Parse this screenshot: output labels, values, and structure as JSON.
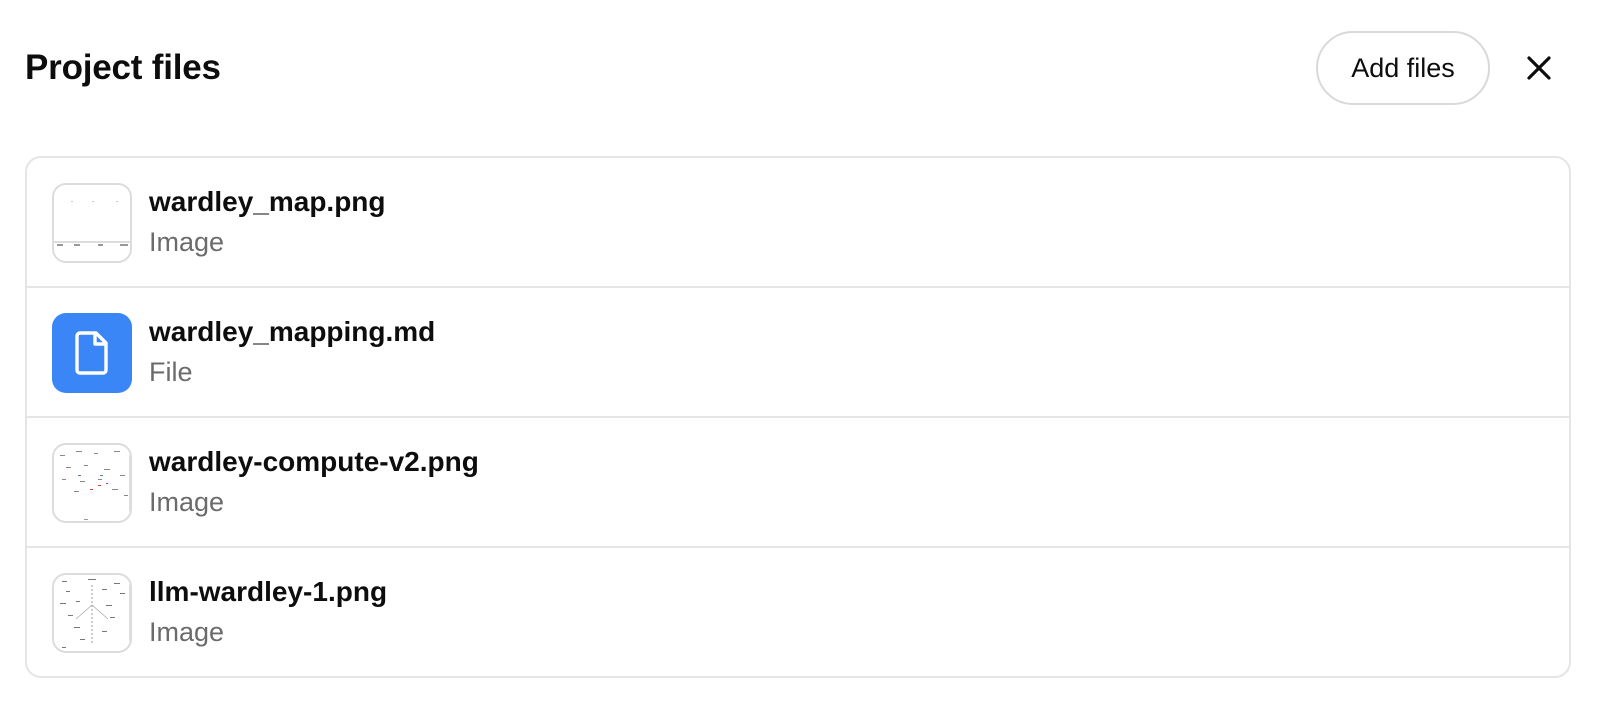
{
  "header": {
    "title": "Project files",
    "add_label": "Add files",
    "close_icon": "close-icon"
  },
  "files": [
    {
      "name": "wardley_map.png",
      "type": "Image",
      "thumbnail": "image-thumbnail"
    },
    {
      "name": "wardley_mapping.md",
      "type": "File",
      "thumbnail": "document-icon",
      "icon_color": "#3b86f6"
    },
    {
      "name": "wardley-compute-v2.png",
      "type": "Image",
      "thumbnail": "image-thumbnail"
    },
    {
      "name": "llm-wardley-1.png",
      "type": "Image",
      "thumbnail": "image-thumbnail"
    }
  ]
}
